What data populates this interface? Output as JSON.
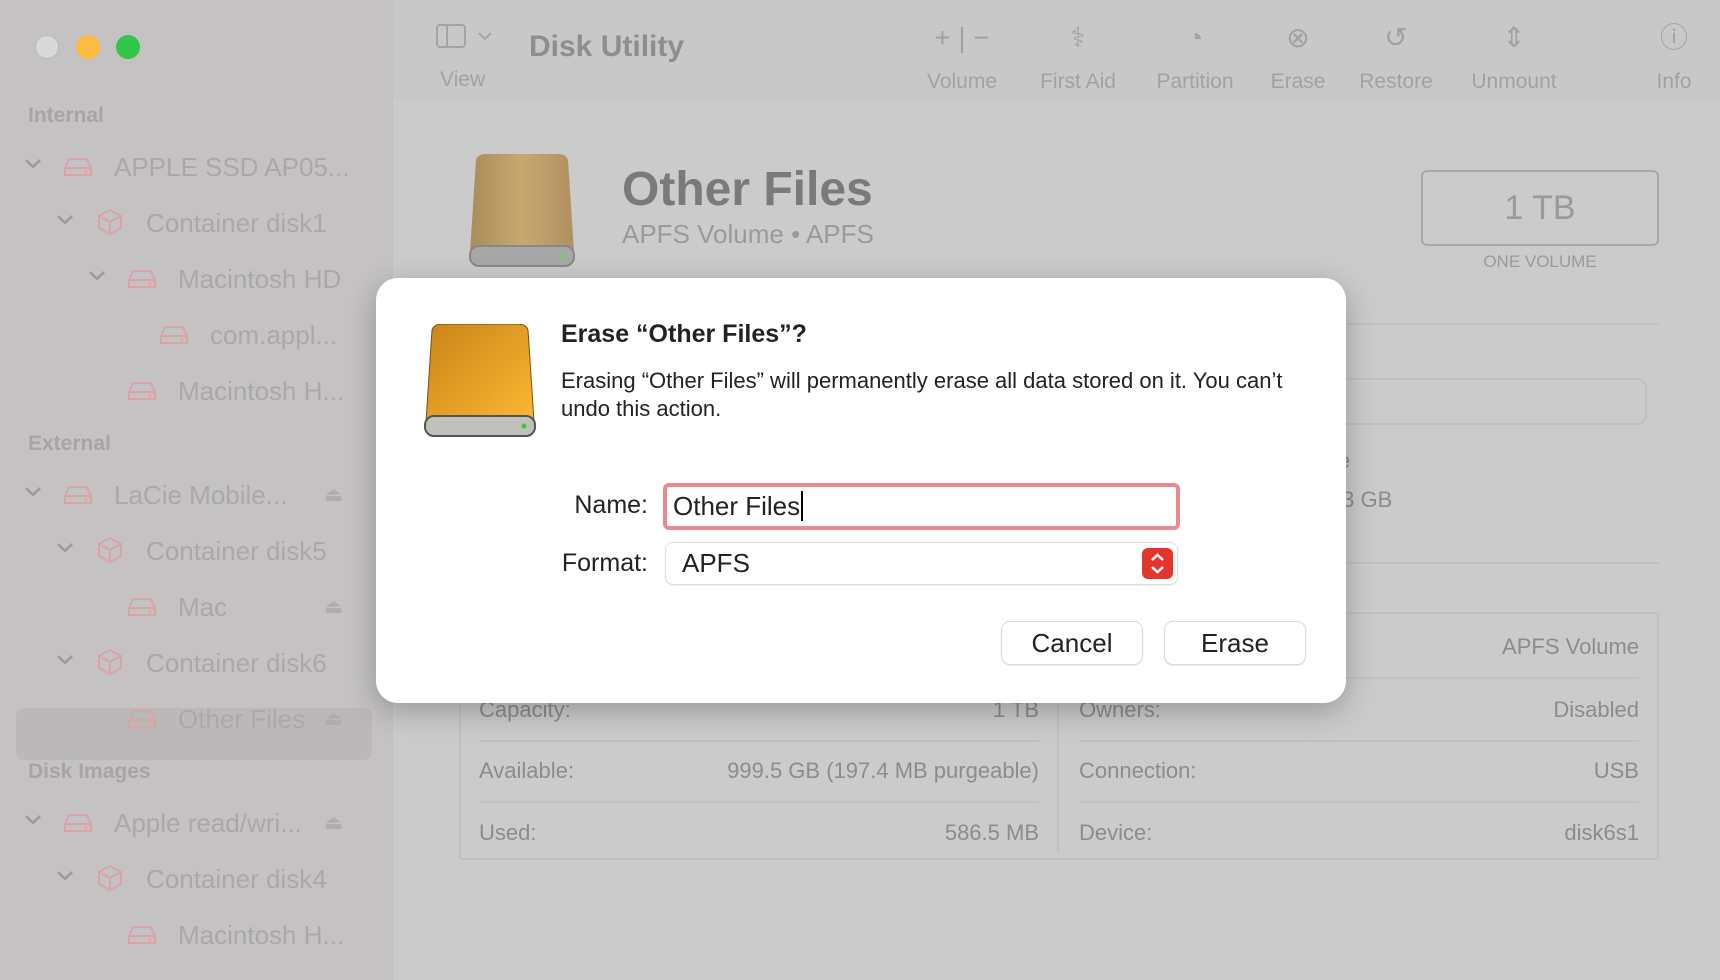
{
  "window": {
    "title": "Disk Utility",
    "traffic_lights": {
      "close": "#dad8d9",
      "minimize": "#fdbc40",
      "zoom": "#33c748"
    }
  },
  "toolbar": {
    "view_label": "View",
    "items": [
      {
        "label": "Volume",
        "icon": "plus-minus-icon"
      },
      {
        "label": "First Aid",
        "icon": "stethoscope-icon"
      },
      {
        "label": "Partition",
        "icon": "pie-chart-icon"
      },
      {
        "label": "Erase",
        "icon": "erase-disk-icon"
      },
      {
        "label": "Restore",
        "icon": "restore-arrow-icon"
      },
      {
        "label": "Unmount",
        "icon": "unmount-icon"
      },
      {
        "label": "Info",
        "icon": "info-icon"
      }
    ]
  },
  "sidebar": {
    "sections": [
      {
        "title": "Internal",
        "items": [
          {
            "label": "APPLE SSD AP05...",
            "level": 0,
            "type": "disk",
            "chevron": true
          },
          {
            "label": "Container disk1",
            "level": 1,
            "type": "container",
            "chevron": true
          },
          {
            "label": "Macintosh HD",
            "level": 2,
            "type": "disk",
            "chevron": true
          },
          {
            "label": "com.appl...",
            "level": 3,
            "type": "disk"
          },
          {
            "label": "Macintosh H...",
            "level": 2,
            "type": "disk"
          }
        ]
      },
      {
        "title": "External",
        "items": [
          {
            "label": "LaCie Mobile...",
            "level": 0,
            "type": "disk",
            "chevron": true,
            "eject": true
          },
          {
            "label": "Container disk5",
            "level": 1,
            "type": "container",
            "chevron": true
          },
          {
            "label": "Mac",
            "level": 2,
            "type": "disk",
            "eject": true
          },
          {
            "label": "Container disk6",
            "level": 1,
            "type": "container",
            "chevron": true
          },
          {
            "label": "Other Files",
            "level": 2,
            "type": "disk",
            "eject": true,
            "selected": true
          }
        ]
      },
      {
        "title": "Disk Images",
        "items": [
          {
            "label": "Apple read/wri...",
            "level": 0,
            "type": "disk",
            "chevron": true,
            "eject": true
          },
          {
            "label": "Container disk4",
            "level": 1,
            "type": "container",
            "chevron": true
          },
          {
            "label": "Macintosh H...",
            "level": 2,
            "type": "disk"
          }
        ]
      }
    ]
  },
  "main": {
    "volume_name": "Other Files",
    "volume_subtitle": "APFS Volume • APFS",
    "size": "1 TB",
    "size_caption": "ONE VOLUME",
    "partial_label": "e",
    "partial_value": ".3 GB",
    "info_left": [
      {
        "label": "Capacity:",
        "value": "1 TB"
      },
      {
        "label": "Available:",
        "value": "999.5 GB (197.4 MB purgeable)"
      },
      {
        "label": "Used:",
        "value": "586.5 MB"
      }
    ],
    "info_right": [
      {
        "label": "",
        "value": "APFS Volume"
      },
      {
        "label": "Owners:",
        "value": "Disabled"
      },
      {
        "label": "Connection:",
        "value": "USB"
      },
      {
        "label": "Device:",
        "value": "disk6s1"
      }
    ]
  },
  "dialog": {
    "title": "Erase “Other Files”?",
    "message": "Erasing “Other Files” will permanently erase all data stored on it. You can’t undo this action.",
    "name_label": "Name:",
    "name_value": "Other Files",
    "format_label": "Format:",
    "format_value": "APFS",
    "cancel_label": "Cancel",
    "erase_label": "Erase",
    "accent": "#e3352b",
    "focus_ring": "#e88a8f"
  }
}
